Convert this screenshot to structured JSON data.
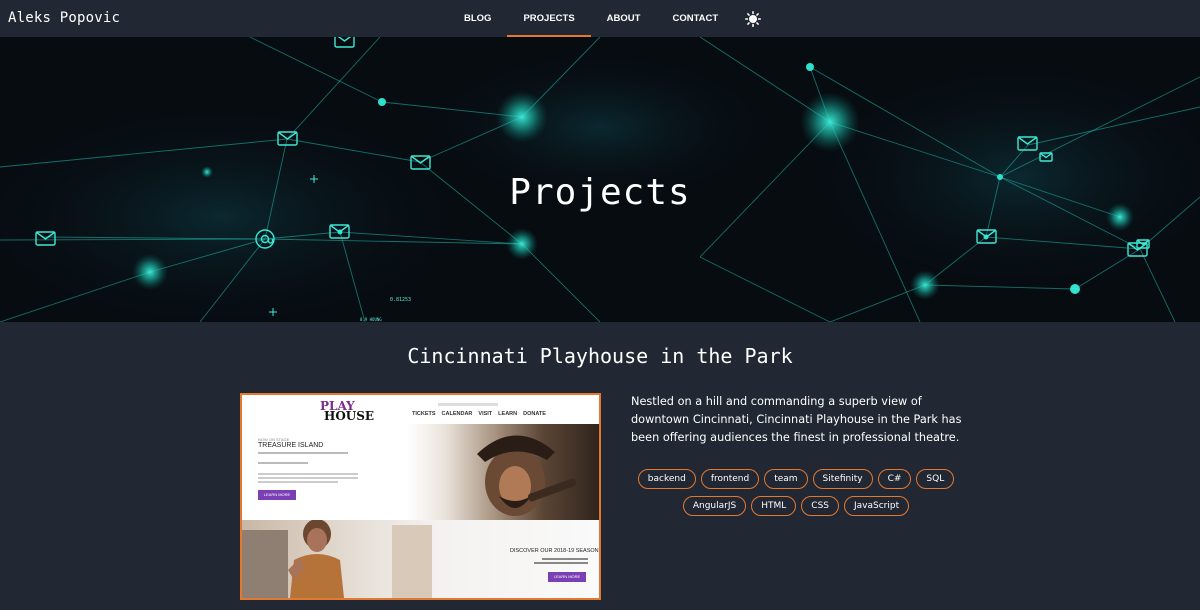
{
  "brand": "Aleks Popovic",
  "nav": {
    "links": [
      "BLOG",
      "PROJECTS",
      "ABOUT",
      "CONTACT"
    ],
    "active": "PROJECTS",
    "theme_icon": "sun-icon"
  },
  "hero": {
    "title": "Projects",
    "overlay_numbers": [
      "0.81253",
      "0.9 HOUNG"
    ]
  },
  "project": {
    "title": "Cincinnati Playhouse in the Park",
    "description": "Nestled on a hill and commanding a superb view of downtown Cincinnati, Cincinnati Playhouse in the Park has been offering audiences the finest in professional theatre.",
    "tags": [
      "backend",
      "frontend",
      "team",
      "Sitefinity",
      "C#",
      "SQL",
      "AngularJS",
      "HTML",
      "CSS",
      "JavaScript"
    ],
    "screenshot": {
      "logo_line1": "PLAY",
      "logo_line2": "HOUSE",
      "nav": [
        "TICKETS",
        "CALENDAR",
        "VISIT",
        "LEARN",
        "DONATE"
      ],
      "subhead": "NOW ON STAGE",
      "show": "TREASURE ISLAND",
      "button1": "LEARN MORE",
      "discover": "DISCOVER OUR 2018-19 SEASON",
      "button2": "LEARN MORE"
    }
  },
  "colors": {
    "background": "#212733",
    "accent": "#e3782f",
    "network": "#1fd1c1"
  }
}
